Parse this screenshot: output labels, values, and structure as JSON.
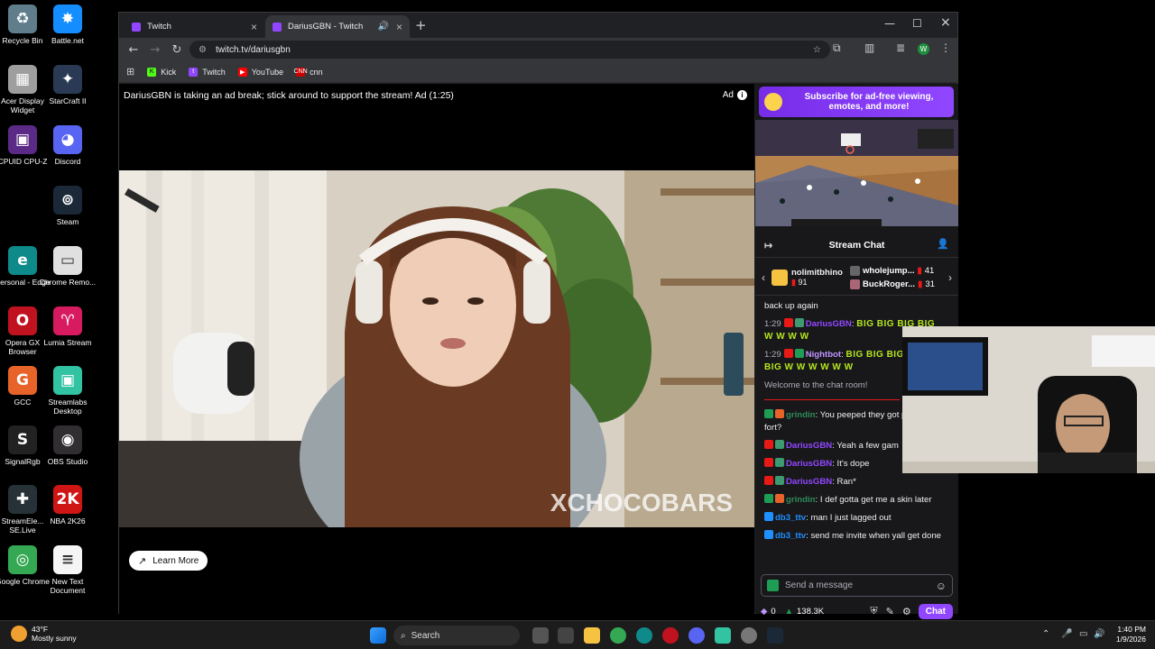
{
  "desktop": {
    "icons": [
      {
        "label": "Recycle Bin",
        "glyph": "♻",
        "color": "#607d8b"
      },
      {
        "label": "Battle.net",
        "glyph": "✸",
        "color": "#148eff"
      },
      {
        "label": "Acer Display Widget",
        "glyph": "▦",
        "color": "#9e9e9e"
      },
      {
        "label": "StarCraft II",
        "glyph": "✦",
        "color": "#2a3a55"
      },
      {
        "label": "CPUID CPU-Z",
        "glyph": "▣",
        "color": "#5b2a86"
      },
      {
        "label": "Discord",
        "glyph": "◕",
        "color": "#5865f2"
      },
      {
        "label": "Steam",
        "glyph": "⊚",
        "color": "#1b2838"
      },
      {
        "label": "Personal - Edge",
        "glyph": "e",
        "color": "#0f8a8a"
      },
      {
        "label": "Chrome Remo...",
        "glyph": "▭",
        "color": "#e0e0e0"
      },
      {
        "label": "Opera GX Browser",
        "glyph": "O",
        "color": "#c1121f"
      },
      {
        "label": "Lumia Stream",
        "glyph": "♈",
        "color": "#d81b60"
      },
      {
        "label": "GCC",
        "glyph": "G",
        "color": "#e8632a"
      },
      {
        "label": "Streamlabs Desktop",
        "glyph": "▣",
        "color": "#31c3a2"
      },
      {
        "label": "SignalRgb",
        "glyph": "S",
        "color": "#222"
      },
      {
        "label": "OBS Studio",
        "glyph": "◉",
        "color": "#302e31"
      },
      {
        "label": "StreamEle... SE.Live",
        "glyph": "✚",
        "color": "#263238"
      },
      {
        "label": "NBA 2K26",
        "glyph": "2K",
        "color": "#d01515"
      },
      {
        "label": "Google Chrome",
        "glyph": "◎",
        "color": "#34a853"
      },
      {
        "label": "New Text Document",
        "glyph": "≡",
        "color": "#f5f5f5"
      }
    ]
  },
  "browser": {
    "tabs": [
      {
        "title": "Twitch"
      },
      {
        "title": "DariusGBN - Twitch"
      }
    ],
    "url": "twitch.tv/dariusgbn",
    "avatar_letter": "W",
    "bookmarks": [
      {
        "label": "Kick",
        "color": "#53fc18",
        "glyph": "K"
      },
      {
        "label": "Twitch",
        "color": "#9146ff",
        "glyph": "t"
      },
      {
        "label": "YouTube",
        "color": "#ff0000",
        "glyph": "▶"
      },
      {
        "label": "cnn",
        "color": "#cc0000",
        "glyph": "CNN"
      }
    ]
  },
  "player": {
    "ad_text": "DariusGBN is taking an ad break; stick around to support the stream! Ad (1:25)",
    "ad_label": "Ad",
    "watermark": "XCHOCOBARS",
    "learn_more": "Learn More"
  },
  "chat": {
    "sub_banner": "Subscribe for ad-free viewing, emotes, and more!",
    "title": "Stream Chat",
    "gifters": [
      {
        "name": "nolimitbhino",
        "count": "91"
      },
      {
        "name": "wholejump...",
        "count": "41"
      },
      {
        "name": "BuckRoger...",
        "count": "31"
      }
    ],
    "messages": {
      "m0": "back up again",
      "m1_time": "1:29",
      "m1_user": "DariusGBN",
      "m1_text": "BIG BIG BIG BIG W W W W",
      "m2_time": "1:29",
      "m2_user": "Nightbot",
      "m2_text": "BIG BIG BIG BIG BIG W W W W W W",
      "welcome": "Welcome to the chat room!",
      "m3_user": "grindin",
      "m3_text": "You peeped they got park on fort?",
      "m4_user": "DariusGBN",
      "m4_text": "Yeah a few gam",
      "m5_user": "DariusGBN",
      "m5_text": "It's dope",
      "m6_user": "DariusGBN",
      "m6_text": "Ran*",
      "m7_user": "grindin",
      "m7_text": "I def gotta get me a skin later",
      "m8_user": "db3_ttv",
      "m8_text": "man I just lagged out",
      "m9_user": "db3_ttv",
      "m9_text": "send me invite when yall get done"
    },
    "placeholder": "Send a message",
    "points_a": "0",
    "points_b": "138.3K",
    "chat_button": "Chat"
  },
  "taskbar": {
    "weather_temp": "43°F",
    "weather_desc": "Mostly sunny",
    "search": "Search",
    "time": "1:40 PM",
    "date": "1/9/2026"
  }
}
